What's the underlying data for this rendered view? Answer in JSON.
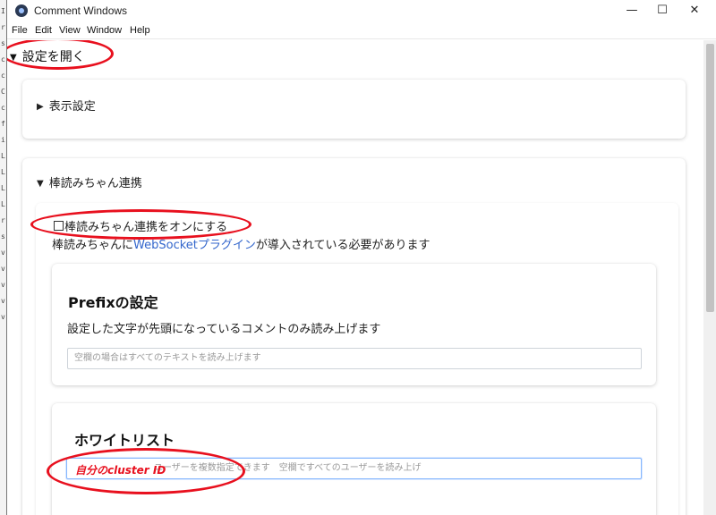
{
  "window": {
    "title": "Comment Windows",
    "controls": {
      "minimize": "—",
      "maximize": "☐",
      "close": "✕"
    }
  },
  "menu": [
    "File",
    "Edit",
    "View",
    "Window",
    "Help"
  ],
  "settings": {
    "open_label": "設定を開く",
    "display_settings": "表示設定",
    "bouyomi": {
      "section_label": "棒読みちゃん連携",
      "enable_label": "棒読みちゃん連携をオンにする",
      "note_before": "棒読みちゃんに",
      "note_link": "WebSocketプラグイン",
      "note_after": "が導入されている必要があります",
      "prefix": {
        "title": "Prefixの設定",
        "description": "設定した文字が先頭になっているコメントのみ読み上げます",
        "placeholder": "空欄の場合はすべてのテキストを読み上げます"
      },
      "whitelist": {
        "title": "ホワイトリスト",
        "placeholder": "ユーザーを複数指定できます　空欄ですべてのユーザーを読み上げ"
      }
    }
  },
  "annotation": {
    "handwritten_text": "自分のcluster ID",
    "color": "#e8101e"
  },
  "left_strip_chars": [
    "I",
    "r",
    "s",
    "c",
    "c",
    "C",
    "c",
    "f",
    "i",
    "L",
    "L",
    "L",
    "L",
    "r",
    "s",
    "v",
    "v",
    "v",
    "v",
    "v"
  ]
}
